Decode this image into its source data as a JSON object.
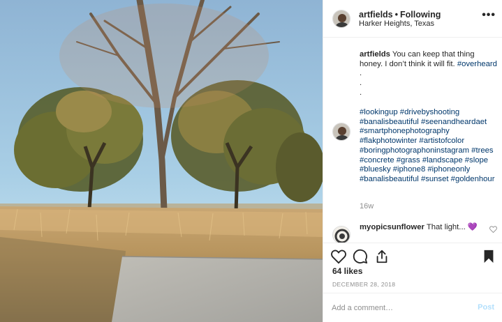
{
  "post": {
    "username": "artfields",
    "follow_status": "Following",
    "location": "Harker Heights, Texas",
    "more_icon": "more-horizontal-icon"
  },
  "caption": {
    "username": "artfields",
    "text": "You can keep that thing honey. I don’t think it will fit.",
    "hashtag": "#overheard",
    "trailing": ".",
    "dot1": ".",
    "dot2": "."
  },
  "hashtags": [
    "#lookingup",
    "#drivebyshooting",
    "#banalisbeautiful",
    "#seenandheardaet",
    "#smartphonephotography",
    "#flakphotowinter",
    "#artistofcolor",
    "#boringphotographoninstagram",
    "#trees",
    "#concrete",
    "#grass",
    "#landscape",
    "#slope",
    "#bluesky",
    "#iphone8",
    "#iphoneonly",
    "#banalisbeautiful",
    "#sunset",
    "#goldenhour"
  ],
  "hashtag_age": "16w",
  "reply": {
    "username": "myopicsunflower",
    "text": "That light...",
    "emoji": "💜"
  },
  "actions": {
    "like_icon": "heart-icon",
    "comment_icon": "comment-icon",
    "share_icon": "share-icon",
    "save_icon": "bookmark-icon"
  },
  "likes": "64 likes",
  "date": "DECEMBER 28, 2018",
  "comment_box": {
    "placeholder": "Add a comment…",
    "post_label": "Post"
  },
  "colors": {
    "link": "#00376b",
    "muted": "#8e8e8e",
    "post_disabled": "#b2dffc",
    "emoji_purple": "#a55fe0"
  }
}
